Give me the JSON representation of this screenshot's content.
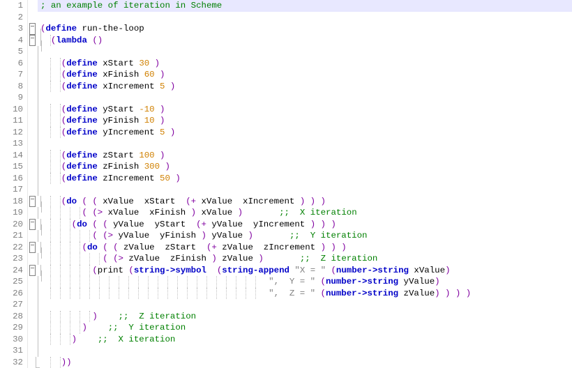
{
  "language": "Scheme",
  "line_count": 32,
  "current_line": 1,
  "colors": {
    "keyword": "#0000c8",
    "number": "#d08000",
    "string": "#808080",
    "comment": "#008000",
    "paren": "#8000a0",
    "current_line_bg": "#e8e8ff"
  },
  "fold_markers": {
    "3": "open",
    "4": "open",
    "18": "open",
    "20": "open",
    "22": "open",
    "24": "open"
  },
  "lines": [
    {
      "n": 1,
      "indent": 0,
      "tokens": [
        {
          "t": "; an example of iteration in Scheme",
          "c": "cmt"
        }
      ]
    },
    {
      "n": 2,
      "indent": 0,
      "tokens": []
    },
    {
      "n": 3,
      "indent": 0,
      "tokens": [
        {
          "t": "(",
          "c": "p"
        },
        {
          "t": "define",
          "c": "kw"
        },
        {
          "t": " run-the-loop",
          "c": "sym"
        }
      ]
    },
    {
      "n": 4,
      "indent": 2,
      "tokens": [
        {
          "t": "(",
          "c": "p"
        },
        {
          "t": "lambda",
          "c": "kw"
        },
        {
          "t": " ",
          "c": "sym"
        },
        {
          "t": "()",
          "c": "p"
        }
      ]
    },
    {
      "n": 5,
      "indent": 0,
      "tokens": []
    },
    {
      "n": 6,
      "indent": 4,
      "tokens": [
        {
          "t": "(",
          "c": "p"
        },
        {
          "t": "define",
          "c": "kw"
        },
        {
          "t": " xStart ",
          "c": "sym"
        },
        {
          "t": "30",
          "c": "num"
        },
        {
          "t": " )",
          "c": "p"
        }
      ]
    },
    {
      "n": 7,
      "indent": 4,
      "tokens": [
        {
          "t": "(",
          "c": "p"
        },
        {
          "t": "define",
          "c": "kw"
        },
        {
          "t": " xFinish ",
          "c": "sym"
        },
        {
          "t": "60",
          "c": "num"
        },
        {
          "t": " )",
          "c": "p"
        }
      ]
    },
    {
      "n": 8,
      "indent": 4,
      "tokens": [
        {
          "t": "(",
          "c": "p"
        },
        {
          "t": "define",
          "c": "kw"
        },
        {
          "t": " xIncrement ",
          "c": "sym"
        },
        {
          "t": "5",
          "c": "num"
        },
        {
          "t": " )",
          "c": "p"
        }
      ]
    },
    {
      "n": 9,
      "indent": 0,
      "tokens": []
    },
    {
      "n": 10,
      "indent": 4,
      "tokens": [
        {
          "t": "(",
          "c": "p"
        },
        {
          "t": "define",
          "c": "kw"
        },
        {
          "t": " yStart ",
          "c": "sym"
        },
        {
          "t": "-10",
          "c": "num"
        },
        {
          "t": " )",
          "c": "p"
        }
      ]
    },
    {
      "n": 11,
      "indent": 4,
      "tokens": [
        {
          "t": "(",
          "c": "p"
        },
        {
          "t": "define",
          "c": "kw"
        },
        {
          "t": " yFinish ",
          "c": "sym"
        },
        {
          "t": "10",
          "c": "num"
        },
        {
          "t": " )",
          "c": "p"
        }
      ]
    },
    {
      "n": 12,
      "indent": 4,
      "tokens": [
        {
          "t": "(",
          "c": "p"
        },
        {
          "t": "define",
          "c": "kw"
        },
        {
          "t": " yIncrement ",
          "c": "sym"
        },
        {
          "t": "5",
          "c": "num"
        },
        {
          "t": " )",
          "c": "p"
        }
      ]
    },
    {
      "n": 13,
      "indent": 0,
      "tokens": []
    },
    {
      "n": 14,
      "indent": 4,
      "tokens": [
        {
          "t": "(",
          "c": "p"
        },
        {
          "t": "define",
          "c": "kw"
        },
        {
          "t": " zStart ",
          "c": "sym"
        },
        {
          "t": "100",
          "c": "num"
        },
        {
          "t": " )",
          "c": "p"
        }
      ]
    },
    {
      "n": 15,
      "indent": 4,
      "tokens": [
        {
          "t": "(",
          "c": "p"
        },
        {
          "t": "define",
          "c": "kw"
        },
        {
          "t": " zFinish ",
          "c": "sym"
        },
        {
          "t": "300",
          "c": "num"
        },
        {
          "t": " )",
          "c": "p"
        }
      ]
    },
    {
      "n": 16,
      "indent": 4,
      "tokens": [
        {
          "t": "(",
          "c": "p"
        },
        {
          "t": "define",
          "c": "kw"
        },
        {
          "t": " zIncrement ",
          "c": "sym"
        },
        {
          "t": "50",
          "c": "num"
        },
        {
          "t": " )",
          "c": "p"
        }
      ]
    },
    {
      "n": 17,
      "indent": 0,
      "tokens": []
    },
    {
      "n": 18,
      "indent": 4,
      "tokens": [
        {
          "t": "(",
          "c": "p"
        },
        {
          "t": "do",
          "c": "kw"
        },
        {
          "t": " ",
          "c": "sym"
        },
        {
          "t": "( (",
          "c": "p"
        },
        {
          "t": " xValue  xStart  ",
          "c": "sym"
        },
        {
          "t": "(+",
          "c": "p"
        },
        {
          "t": " xValue  xIncrement ",
          "c": "sym"
        },
        {
          "t": ") ) )",
          "c": "p"
        }
      ]
    },
    {
      "n": 19,
      "indent": 8,
      "tokens": [
        {
          "t": "( (>",
          "c": "p"
        },
        {
          "t": " xValue  xFinish ",
          "c": "sym"
        },
        {
          "t": ")",
          "c": "p"
        },
        {
          "t": " xValue ",
          "c": "sym"
        },
        {
          "t": ")       ",
          "c": "p"
        },
        {
          "t": ";;  X iteration",
          "c": "cmt"
        }
      ]
    },
    {
      "n": 20,
      "indent": 6,
      "tokens": [
        {
          "t": "(",
          "c": "p"
        },
        {
          "t": "do",
          "c": "kw"
        },
        {
          "t": " ",
          "c": "sym"
        },
        {
          "t": "( (",
          "c": "p"
        },
        {
          "t": " yValue  yStart  ",
          "c": "sym"
        },
        {
          "t": "(+",
          "c": "p"
        },
        {
          "t": " yValue  yIncrement ",
          "c": "sym"
        },
        {
          "t": ") ) )",
          "c": "p"
        }
      ]
    },
    {
      "n": 21,
      "indent": 10,
      "tokens": [
        {
          "t": "( (>",
          "c": "p"
        },
        {
          "t": " yValue  yFinish ",
          "c": "sym"
        },
        {
          "t": ")",
          "c": "p"
        },
        {
          "t": " yValue ",
          "c": "sym"
        },
        {
          "t": ")       ",
          "c": "p"
        },
        {
          "t": ";;  Y iteration",
          "c": "cmt"
        }
      ]
    },
    {
      "n": 22,
      "indent": 8,
      "tokens": [
        {
          "t": "(",
          "c": "p"
        },
        {
          "t": "do",
          "c": "kw"
        },
        {
          "t": " ",
          "c": "sym"
        },
        {
          "t": "( (",
          "c": "p"
        },
        {
          "t": " zValue  zStart  ",
          "c": "sym"
        },
        {
          "t": "(+",
          "c": "p"
        },
        {
          "t": " zValue  zIncrement ",
          "c": "sym"
        },
        {
          "t": ") ) )",
          "c": "p"
        }
      ]
    },
    {
      "n": 23,
      "indent": 12,
      "tokens": [
        {
          "t": "( (>",
          "c": "p"
        },
        {
          "t": " zValue  zFinish ",
          "c": "sym"
        },
        {
          "t": ")",
          "c": "p"
        },
        {
          "t": " zValue ",
          "c": "sym"
        },
        {
          "t": ")       ",
          "c": "p"
        },
        {
          "t": ";;  Z iteration",
          "c": "cmt"
        }
      ]
    },
    {
      "n": 24,
      "indent": 10,
      "tokens": [
        {
          "t": "(",
          "c": "p"
        },
        {
          "t": "print ",
          "c": "sym"
        },
        {
          "t": "(",
          "c": "p"
        },
        {
          "t": "string->symbol",
          "c": "kw"
        },
        {
          "t": "  ",
          "c": "sym"
        },
        {
          "t": "(",
          "c": "p"
        },
        {
          "t": "string-append",
          "c": "kw"
        },
        {
          "t": " ",
          "c": "sym"
        },
        {
          "t": "\"X = \"",
          "c": "str"
        },
        {
          "t": " ",
          "c": "sym"
        },
        {
          "t": "(",
          "c": "p"
        },
        {
          "t": "number->string",
          "c": "kw"
        },
        {
          "t": " xValue",
          "c": "sym"
        },
        {
          "t": ")",
          "c": "p"
        }
      ]
    },
    {
      "n": 25,
      "indent": 44,
      "tokens": [
        {
          "t": "\",  Y = \"",
          "c": "str"
        },
        {
          "t": " ",
          "c": "sym"
        },
        {
          "t": "(",
          "c": "p"
        },
        {
          "t": "number->string",
          "c": "kw"
        },
        {
          "t": " yValue",
          "c": "sym"
        },
        {
          "t": ")",
          "c": "p"
        }
      ]
    },
    {
      "n": 26,
      "indent": 44,
      "tokens": [
        {
          "t": "\",  Z = \"",
          "c": "str"
        },
        {
          "t": " ",
          "c": "sym"
        },
        {
          "t": "(",
          "c": "p"
        },
        {
          "t": "number->string",
          "c": "kw"
        },
        {
          "t": " zValue",
          "c": "sym"
        },
        {
          "t": ") ) ) )",
          "c": "p"
        }
      ]
    },
    {
      "n": 27,
      "indent": 0,
      "tokens": []
    },
    {
      "n": 28,
      "indent": 10,
      "tokens": [
        {
          "t": ")    ",
          "c": "p"
        },
        {
          "t": ";;  Z iteration",
          "c": "cmt"
        }
      ]
    },
    {
      "n": 29,
      "indent": 8,
      "tokens": [
        {
          "t": ")    ",
          "c": "p"
        },
        {
          "t": ";;  Y iteration",
          "c": "cmt"
        }
      ]
    },
    {
      "n": 30,
      "indent": 6,
      "tokens": [
        {
          "t": ")    ",
          "c": "p"
        },
        {
          "t": ";;  X iteration",
          "c": "cmt"
        }
      ]
    },
    {
      "n": 31,
      "indent": 0,
      "tokens": []
    },
    {
      "n": 32,
      "indent": 4,
      "tokens": [
        {
          "t": "))",
          "c": "p"
        }
      ]
    }
  ]
}
